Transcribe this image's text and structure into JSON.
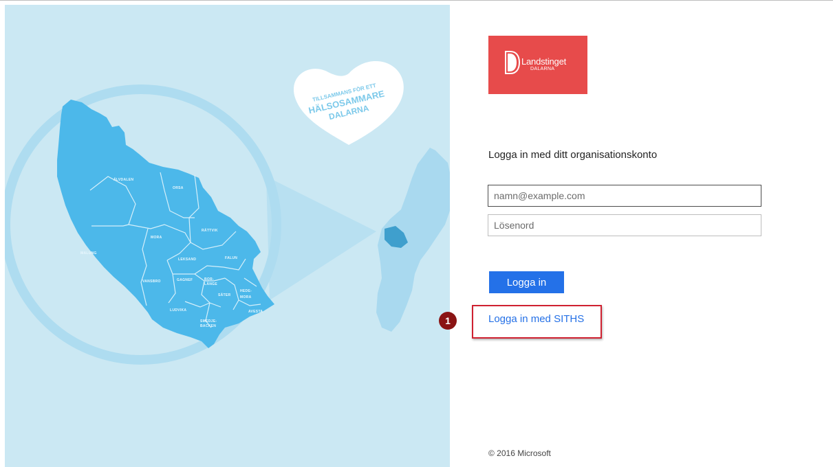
{
  "illustration": {
    "heart_lines": [
      "TILLSAMMANS FÖR ETT",
      "HÄLSOSAMMARE",
      "DALARNA"
    ],
    "municipalities": [
      "ÄLVDALEN",
      "ORSA",
      "MORA",
      "RÄTTVIK",
      "MALUNG",
      "LEKSAND",
      "FALUN",
      "VANSBRO",
      "GAGNEF",
      "BOR-",
      "LÄNGE",
      "SÄTER",
      "HEDE-",
      "MORA",
      "LUDVIKA",
      "AVESTA",
      "SMEDJE-",
      "BACKEN"
    ]
  },
  "logo": {
    "title": "Landstinget",
    "subtitle": "DALARNA",
    "icon": "landstinget-d-mark-icon"
  },
  "form": {
    "heading": "Logga in med ditt organisationskonto",
    "email_placeholder": "namn@example.com",
    "password_placeholder": "Lösenord",
    "submit_label": "Logga in",
    "siths_link": "Logga in med SITHS",
    "callout_number": "1"
  },
  "footer": {
    "copyright": "© 2016 Microsoft"
  },
  "colors": {
    "panel": "#cbe8f3",
    "map": "#4cb8ea",
    "logo": "#e74b4b",
    "button": "#2471e8",
    "highlight": "#cf2030",
    "callout": "#8a1414"
  }
}
